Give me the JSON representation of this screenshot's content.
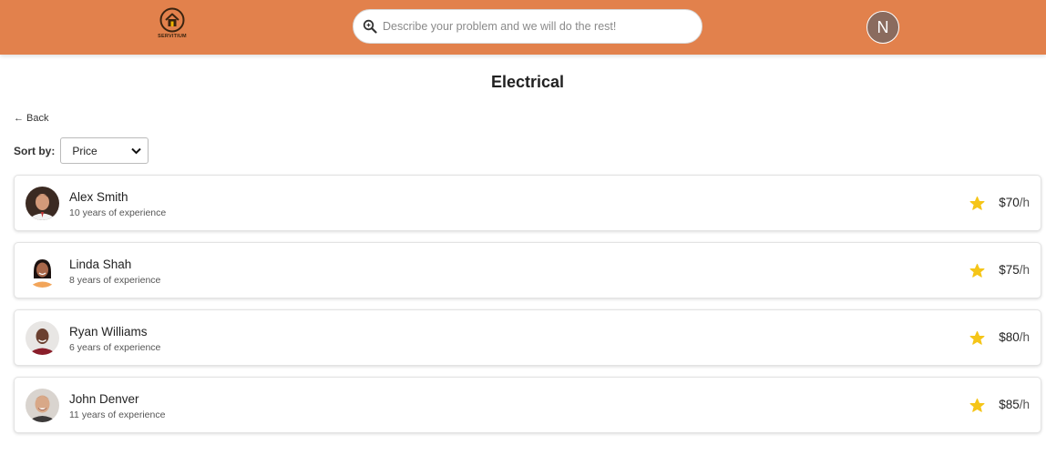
{
  "header": {
    "logo_text": "SERVITIUM",
    "search_placeholder": "Describe your problem and we will do the rest!",
    "user_initial": "N"
  },
  "page": {
    "title": "Electrical",
    "back_label": "← Back",
    "sort_label": "Sort by:",
    "sort_value": "Price"
  },
  "workers": [
    {
      "name": "Alex Smith",
      "experience": "10 years of experience",
      "price": "$70",
      "unit": "/h"
    },
    {
      "name": "Linda Shah",
      "experience": "8 years of experience",
      "price": "$75",
      "unit": "/h"
    },
    {
      "name": "Ryan Williams",
      "experience": "6 years of experience",
      "price": "$80",
      "unit": "/h"
    },
    {
      "name": "John Denver",
      "experience": "11 years of experience",
      "price": "$85",
      "unit": "/h"
    }
  ],
  "colors": {
    "header_bg": "#e2814c",
    "star": "#f5c518"
  }
}
